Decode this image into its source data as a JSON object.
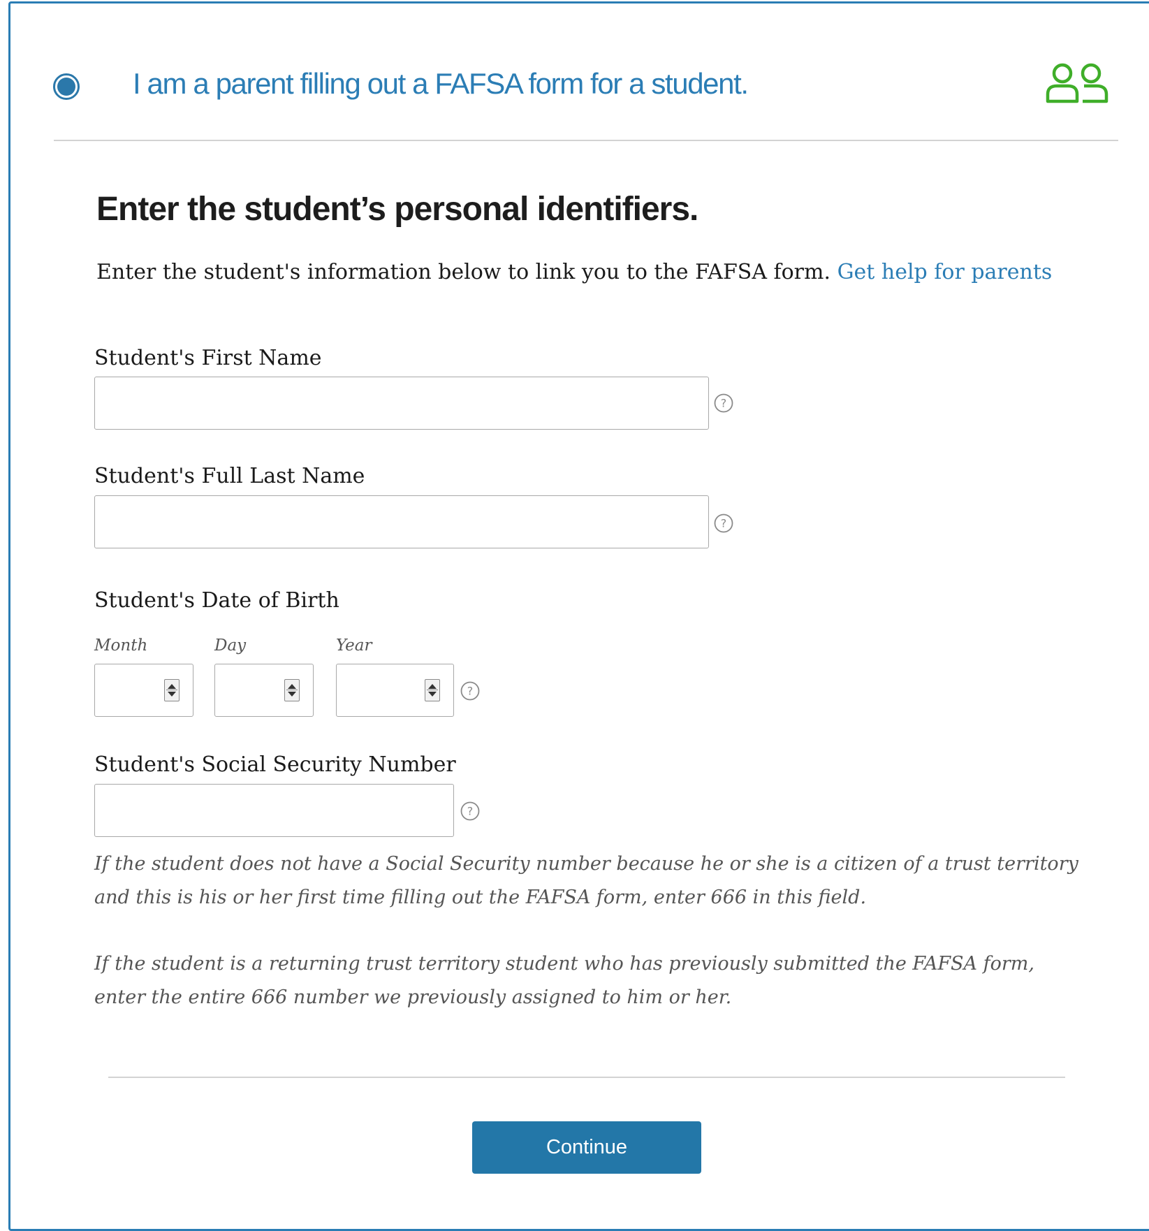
{
  "role": {
    "title": "I am a parent filling out a FAFSA form for a student.",
    "selected": true,
    "icon": "parents-icon",
    "accent_color": "#2b7db5",
    "icon_color": "#3fae29"
  },
  "form": {
    "heading": "Enter the student’s personal identifiers.",
    "intro_text": "Enter the student's information below to link you to the FAFSA form.",
    "help_link": "Get help for parents",
    "first_name": {
      "label": "Student's First Name",
      "value": ""
    },
    "last_name": {
      "label": "Student's Full Last Name",
      "value": ""
    },
    "dob": {
      "label": "Student's Date of Birth",
      "month_label": "Month",
      "day_label": "Day",
      "year_label": "Year",
      "month_value": "",
      "day_value": "",
      "year_value": ""
    },
    "ssn": {
      "label": "Student's Social Security Number",
      "value": ""
    },
    "note_1": "If the student does not have a Social Security number because he or she is a citizen of a trust territory and this is his or her first time filling out the FAFSA form, enter 666 in this field.",
    "note_2": "If the student is a returning trust territory student who has previously submitted the FAFSA form, enter the entire 666 number we previously assigned to him or her."
  },
  "actions": {
    "continue_label": "Continue",
    "button_color": "#2377a8"
  }
}
